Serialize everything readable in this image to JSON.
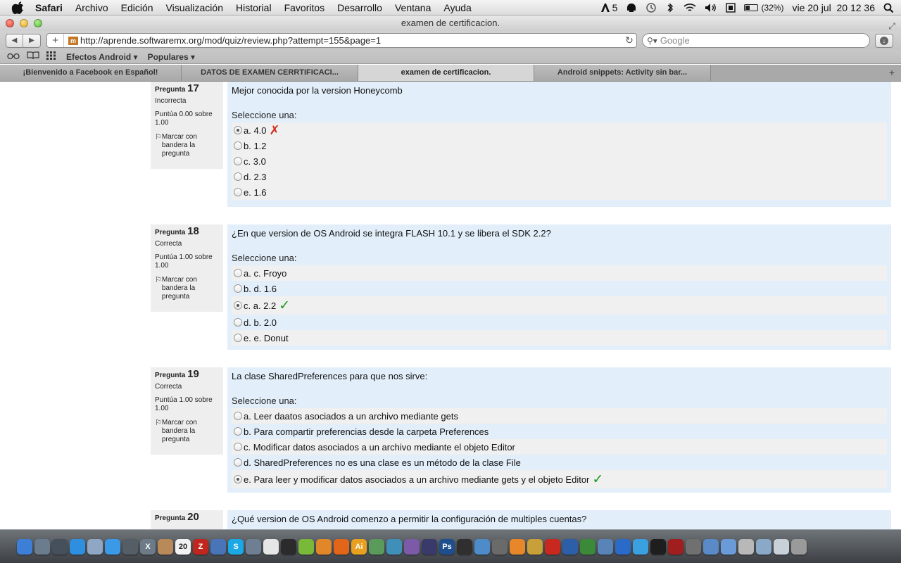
{
  "menubar": {
    "app_name": "Safari",
    "items": [
      "Archivo",
      "Edición",
      "Visualización",
      "Historial",
      "Favoritos",
      "Desarrollo",
      "Ventana",
      "Ayuda"
    ],
    "adobe_count": "5",
    "battery_percent": "(32%)",
    "battery_level": 0.32,
    "clock": "vie 20 jul  20 12 36"
  },
  "window": {
    "title": "examen de certificacion."
  },
  "toolbar": {
    "url": "http://aprende.softwaremx.org/mod/quiz/review.php?attempt=155&page=1",
    "search_placeholder": "Google"
  },
  "bookmarks": {
    "items": [
      "Efectos Android ▾",
      "Populares ▾"
    ]
  },
  "tabs": [
    {
      "label": "¡Bienvenido a Facebook en Español!",
      "active": false
    },
    {
      "label": "DATOS DE EXAMEN CERRTIFICACI...",
      "active": false
    },
    {
      "label": "examen de certificacion.",
      "active": true
    },
    {
      "label": "Android snippets: Activity sin bar...",
      "active": false
    }
  ],
  "questions": [
    {
      "prefix": "Pregunta",
      "number": "17",
      "state": "Incorrecta",
      "grade": "Puntúa 0.00 sobre 1.00",
      "flag_label": "Marcar con bandera la pregunta",
      "text": "Mejor conocida por la version Honeycomb",
      "prompt": "Seleccione una:",
      "options": [
        {
          "label": "a. 4.0",
          "selected": true,
          "mark": "incorrect"
        },
        {
          "label": "b. 1.2",
          "selected": false,
          "mark": ""
        },
        {
          "label": "c. 3.0",
          "selected": false,
          "mark": ""
        },
        {
          "label": "d. 2.3",
          "selected": false,
          "mark": ""
        },
        {
          "label": "e. 1.6",
          "selected": false,
          "mark": ""
        }
      ]
    },
    {
      "prefix": "Pregunta",
      "number": "18",
      "state": "Correcta",
      "grade": "Puntúa 1.00 sobre 1.00",
      "flag_label": "Marcar con bandera la pregunta",
      "text": "¿En que version de OS Android se integra FLASH 10.1 y se libera el SDK 2.2?",
      "prompt": "Seleccione una:",
      "options": [
        {
          "label": "a. c. Froyo",
          "selected": false,
          "mark": ""
        },
        {
          "label": "b. d. 1.6",
          "selected": false,
          "mark": ""
        },
        {
          "label": "c. a. 2.2",
          "selected": true,
          "mark": "correct"
        },
        {
          "label": "d. b. 2.0",
          "selected": false,
          "mark": ""
        },
        {
          "label": "e. e. Donut",
          "selected": false,
          "mark": ""
        }
      ]
    },
    {
      "prefix": "Pregunta",
      "number": "19",
      "state": "Correcta",
      "grade": "Puntúa 1.00 sobre 1.00",
      "flag_label": "Marcar con bandera la pregunta",
      "text": "La clase SharedPreferences para que nos sirve:",
      "prompt": "Seleccione una:",
      "options": [
        {
          "label": "a. Leer daatos asociados a un archivo mediante gets",
          "selected": false,
          "mark": ""
        },
        {
          "label": "b. Para compartir preferencias desde la carpeta Preferences",
          "selected": false,
          "mark": ""
        },
        {
          "label": "c. Modificar datos asociados a un archivo mediante el objeto Editor",
          "selected": false,
          "mark": ""
        },
        {
          "label": "d. SharedPreferences no es una clase es un método de la clase File",
          "selected": false,
          "mark": ""
        },
        {
          "label": "e. Para leer y modificar datos asociados a un archivo mediante gets y el objeto Editor",
          "selected": true,
          "mark": "correct"
        }
      ]
    },
    {
      "prefix": "Pregunta",
      "number": "20",
      "text": "¿Qué version de OS Android comenzo a permitir la configuración de multiples cuentas?"
    }
  ],
  "marks": {
    "incorrect": "✗",
    "correct": "✓"
  },
  "dock": {
    "calendar_day": "20",
    "icons": [
      {
        "name": "finder-icon",
        "color": "#3d7fd6",
        "glyph": ""
      },
      {
        "name": "launchpad-icon",
        "color": "#6b7c8f",
        "glyph": ""
      },
      {
        "name": "mission-control-icon",
        "color": "#45505c",
        "glyph": ""
      },
      {
        "name": "app-store-icon",
        "color": "#2e8fe0",
        "glyph": ""
      },
      {
        "name": "preview-icon",
        "color": "#8fa7c4",
        "glyph": ""
      },
      {
        "name": "safari-icon",
        "color": "#3a9ae8",
        "glyph": ""
      },
      {
        "name": "facetime-icon",
        "color": "#555d66",
        "glyph": ""
      },
      {
        "name": "x11-icon",
        "color": "#6d7a88",
        "glyph": "X"
      },
      {
        "name": "contacts-icon",
        "color": "#b88a5a",
        "glyph": ""
      },
      {
        "name": "calendar-icon",
        "color": "#f2f2f2",
        "glyph": ""
      },
      {
        "name": "filezilla-icon",
        "color": "#c0261d",
        "glyph": "Z"
      },
      {
        "name": "virtualbox-icon",
        "color": "#4a74b8",
        "glyph": ""
      },
      {
        "name": "skype-icon",
        "color": "#1aa8e6",
        "glyph": "S"
      },
      {
        "name": "xcode-icon",
        "color": "#6e7f93",
        "glyph": ""
      },
      {
        "name": "textedit-icon",
        "color": "#e6e6e6",
        "glyph": ""
      },
      {
        "name": "terminal-icon",
        "color": "#2b2b2b",
        "glyph": ""
      },
      {
        "name": "android-icon",
        "color": "#7ab83a",
        "glyph": ""
      },
      {
        "name": "blender-icon",
        "color": "#e0872a",
        "glyph": ""
      },
      {
        "name": "firefox-icon",
        "color": "#e2661a",
        "glyph": ""
      },
      {
        "name": "illustrator-icon",
        "color": "#e8a020",
        "glyph": "Ai"
      },
      {
        "name": "adium-icon",
        "color": "#5a9a5a",
        "glyph": ""
      },
      {
        "name": "system-icon",
        "color": "#3f8fb8",
        "glyph": ""
      },
      {
        "name": "photo-icon",
        "color": "#7b5aa8",
        "glyph": ""
      },
      {
        "name": "eclipse-icon",
        "color": "#3a3a6a",
        "glyph": ""
      },
      {
        "name": "photoshop-icon",
        "color": "#1e4f8c",
        "glyph": "Ps"
      },
      {
        "name": "unity-icon",
        "color": "#2f2f2f",
        "glyph": ""
      },
      {
        "name": "cube-icon",
        "color": "#4d8cc9",
        "glyph": ""
      },
      {
        "name": "tool-icon",
        "color": "#6a6a6a",
        "glyph": ""
      },
      {
        "name": "vlc-icon",
        "color": "#e8872a",
        "glyph": ""
      },
      {
        "name": "stuffit-icon",
        "color": "#c8a03a",
        "glyph": ""
      },
      {
        "name": "angry-birds-icon",
        "color": "#c8281e",
        "glyph": ""
      },
      {
        "name": "globe-icon",
        "color": "#2d5fa8",
        "glyph": ""
      },
      {
        "name": "flower-icon",
        "color": "#3a8a3a",
        "glyph": ""
      },
      {
        "name": "utility-icon",
        "color": "#5a84b8",
        "glyph": ""
      },
      {
        "name": "itunes-icon",
        "color": "#2a6ac8",
        "glyph": ""
      },
      {
        "name": "twitter-icon",
        "color": "#3aa0e0",
        "glyph": ""
      },
      {
        "name": "console-icon",
        "color": "#1e1e1e",
        "glyph": ""
      },
      {
        "name": "books-icon",
        "color": "#a01e1e",
        "glyph": ""
      },
      {
        "name": "settings-icon",
        "color": "#707070",
        "glyph": ""
      },
      {
        "name": "pen-icon",
        "color": "#5a8ac8",
        "glyph": ""
      },
      {
        "name": "folder-icon",
        "color": "#6a9ad8",
        "glyph": ""
      },
      {
        "name": "printer-icon",
        "color": "#b8b8b8",
        "glyph": ""
      },
      {
        "name": "downloads-icon",
        "color": "#8aa8c8",
        "glyph": ""
      },
      {
        "name": "documents-icon",
        "color": "#c8d0d8",
        "glyph": ""
      },
      {
        "name": "trash-icon",
        "color": "#9a9a9a",
        "glyph": ""
      }
    ]
  }
}
